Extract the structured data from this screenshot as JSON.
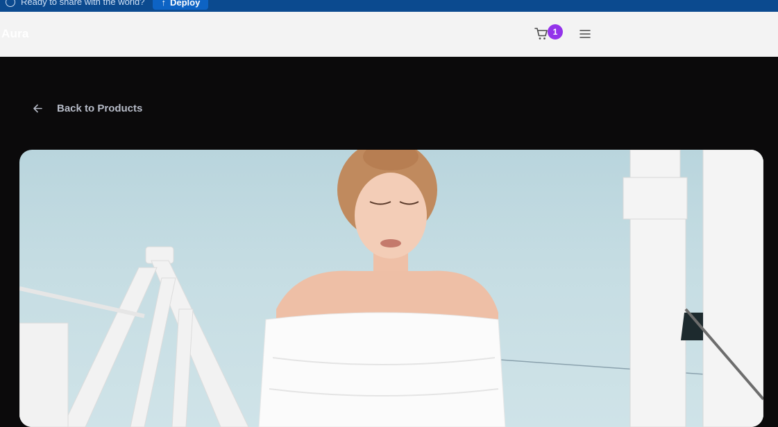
{
  "banner": {
    "text": "Ready to share with the world?",
    "deploy_label": "Deploy"
  },
  "header": {
    "logo": "Aura",
    "cart_count": "1"
  },
  "nav": {
    "back_label": "Back to Products"
  },
  "icons": {
    "banner": "info-circle-icon",
    "deploy": "upload-icon",
    "cart": "shopping-cart-icon",
    "menu": "hamburger-menu-icon",
    "back": "arrow-left-icon"
  },
  "colors": {
    "banner_bg": "#0b4a8f",
    "deploy_button": "#0d63c4",
    "header_bg": "#f3f3f3",
    "page_bg": "#0b0a0b",
    "badge": "#9333ea",
    "back_label": "#b7bcc8"
  }
}
